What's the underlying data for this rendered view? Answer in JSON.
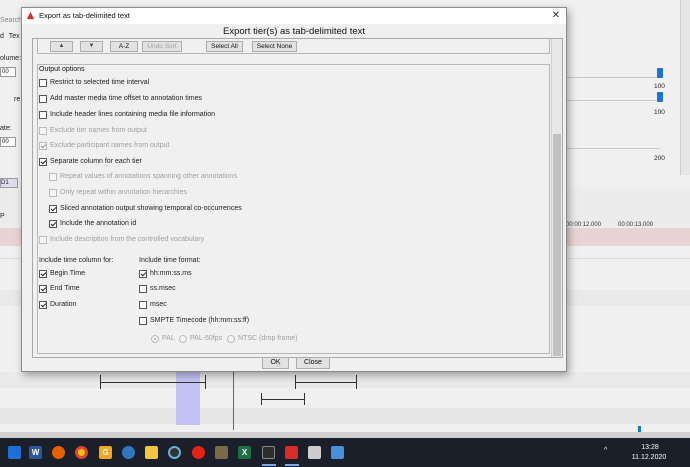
{
  "background": {
    "search_text": "Search",
    "menu": [
      "d",
      "Tex"
    ],
    "volume_label": "olume:",
    "volume_value": "00",
    "rate_label": "ate:",
    "rate_value": "00",
    "re_label": "re",
    "slider_values": [
      "100",
      "100",
      "200"
    ],
    "tab_label": "D1",
    "ruler_ticks": [
      "00:00:12.000",
      "00:00:13.000"
    ],
    "row_label": "P"
  },
  "taskbar": {
    "icons": [
      "windows-icon",
      "word-icon",
      "firefox-icon",
      "chrome-icon",
      "g-app-icon",
      "edge-icon",
      "files-icon",
      "davinci-icon",
      "youtube-icon",
      "gimp-icon",
      "excel-icon",
      "explorer-icon",
      "elan-icon",
      "meeting-icon",
      "elan-exe-icon"
    ],
    "time": "13:28",
    "date": "11.12.2020"
  },
  "dialog": {
    "window_title": "Export as tab-delimited text",
    "heading": "Export tier(s) as tab-delimited text",
    "tier_buttons": {
      "up": "▲",
      "down": "▼",
      "az": "A-Z",
      "undo_sort": "Undo Sort",
      "select_all": "Select All",
      "select_none": "Select None"
    },
    "output_options_title": "Output options",
    "options": [
      {
        "label": "Restrict to selected time interval",
        "checked": false,
        "enabled": true
      },
      {
        "label": "Add master media time offset to annotation times",
        "checked": false,
        "enabled": true
      },
      {
        "label": "Include header lines containing media file information",
        "checked": false,
        "enabled": true
      },
      {
        "label": "Exclude tier names from output",
        "checked": false,
        "enabled": false
      },
      {
        "label": "Exclude participant names from output",
        "checked": true,
        "enabled": false
      },
      {
        "label": "Separate column for each tier",
        "checked": true,
        "enabled": true
      },
      {
        "label": "Repeat values of annotations spanning other annotations",
        "checked": false,
        "enabled": false
      },
      {
        "label": "Only repeat within annotation hierarchies",
        "checked": false,
        "enabled": false
      },
      {
        "label": "Sliced annotation output showing temporal co-occurrences",
        "checked": true,
        "enabled": true
      },
      {
        "label": "Include the annotation id",
        "checked": true,
        "enabled": true
      },
      {
        "label": "Include description from the controlled vocabulary",
        "checked": false,
        "enabled": false
      }
    ],
    "time_column_title": "Include time column for:",
    "time_columns": [
      {
        "label": "Begin Time",
        "checked": true
      },
      {
        "label": "End Time",
        "checked": true
      },
      {
        "label": "Duration",
        "checked": true
      }
    ],
    "time_format_title": "Include time format:",
    "time_formats": [
      {
        "label": "hh:mm:ss.ms",
        "checked": true
      },
      {
        "label": "ss.msec",
        "checked": false
      },
      {
        "label": "msec",
        "checked": false
      },
      {
        "label": "SMPTE Timecode (hh:mm:ss:ff)",
        "checked": false
      }
    ],
    "smpte_options": [
      {
        "label": "PAL",
        "selected": true
      },
      {
        "label": "PAL-50fps",
        "selected": false
      },
      {
        "label": "NTSC (drop frame)",
        "selected": false
      }
    ],
    "ok_label": "OK",
    "close_label": "Close",
    "close_glyph": "✕"
  }
}
